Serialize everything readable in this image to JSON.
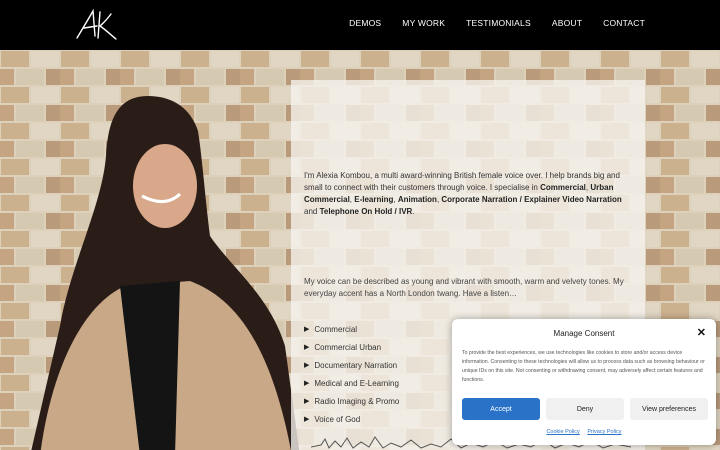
{
  "header": {
    "logo_text": "AK",
    "nav": [
      "DEMOS",
      "MY WORK",
      "TESTIMONIALS",
      "ABOUT",
      "CONTACT"
    ]
  },
  "intro": {
    "p1_a": "I'm Alexia Kombou, a multi award-winning British female voice over. I help brands big and small to connect with their customers through voice. I specialise in ",
    "k1": "Commercial",
    "sep1": ", ",
    "k2": "Urban Commercial",
    "sep2": ", ",
    "k3": "E-learning",
    "sep3": ", ",
    "k4": "Animation",
    "sep4": ", ",
    "k5": "Corporate Narration / Explainer Video Narration",
    "sep5": " and ",
    "k6": "Telephone On Hold / IVR",
    "end": "."
  },
  "voice_text": "My voice can be described as young and vibrant with smooth, warm and velvety tones. My everyday accent has a North London twang. Have a listen…",
  "demos": [
    "Commercial",
    "Commercial Urban",
    "Documentary Narration",
    "Medical and E-Learning",
    "Radio Imaging & Promo",
    "Voice of God"
  ],
  "consent": {
    "title": "Manage Consent",
    "body": "To provide the best experiences, we use technologies like cookies to store and/or access device information. Consenting to these technologies will allow us to process data such as browsing behaviour or unique IDs on this site. Not consenting or withdrawing consent, may adversely affect certain features and functions.",
    "accept": "Accept",
    "deny": "Deny",
    "preferences": "View preferences",
    "cookie_policy": "Cookie Policy",
    "privacy_policy": "Privacy Policy"
  },
  "colors": {
    "accent": "#2a72c8",
    "header_bg": "#000000"
  }
}
